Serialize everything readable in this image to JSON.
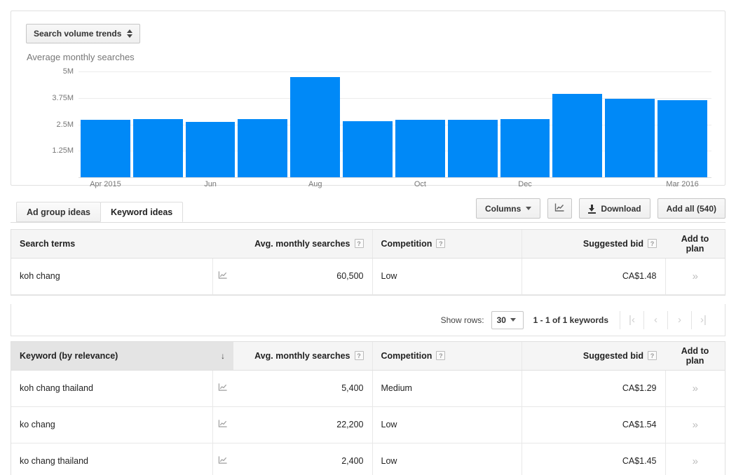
{
  "chart_panel": {
    "trend_selector_label": "Search volume trends",
    "subtitle": "Average monthly searches"
  },
  "chart_data": {
    "type": "bar",
    "title": "Average monthly searches",
    "xlabel": "",
    "ylabel": "",
    "ylim": [
      0,
      5000000
    ],
    "grid": true,
    "legend": false,
    "ytick_labels": [
      "5M",
      "3.75M",
      "2.5M",
      "1.25M"
    ],
    "ytick_values": [
      5000000,
      3750000,
      2500000,
      1250000
    ],
    "categories": [
      "Apr 2015",
      "May 2015",
      "Jun 2015",
      "Jul 2015",
      "Aug 2015",
      "Sep 2015",
      "Oct 2015",
      "Nov 2015",
      "Dec 2015",
      "Jan 2016",
      "Feb 2016",
      "Mar 2016"
    ],
    "visible_xtick_labels": [
      "Apr 2015",
      "",
      "Jun",
      "",
      "Aug",
      "",
      "Oct",
      "",
      "Dec",
      "",
      "",
      "Mar 2016"
    ],
    "values": [
      2700000,
      2750000,
      2600000,
      2750000,
      4750000,
      2650000,
      2700000,
      2720000,
      2760000,
      3950000,
      3700000,
      3650000
    ],
    "bar_color": "#0089f7"
  },
  "tabs": [
    {
      "label": "Ad group ideas",
      "active": false
    },
    {
      "label": "Keyword ideas",
      "active": true
    }
  ],
  "toolbar": {
    "columns_label": "Columns",
    "chart_toggle_label": "",
    "download_label": "Download",
    "add_all_label": "Add all (540)"
  },
  "search_terms_table": {
    "columns": [
      "Search terms",
      "",
      "Avg. monthly searches",
      "Competition",
      "Suggested bid",
      "Add to plan"
    ],
    "help_marker": "?",
    "rows": [
      {
        "keyword": "koh chang",
        "avg_monthly_searches": "60,500",
        "competition": "Low",
        "suggested_bid": "CA$1.48",
        "add_to_plan": "»"
      }
    ]
  },
  "pagination": {
    "show_rows_label": "Show rows:",
    "rows_value": "30",
    "range_label": "1 - 1 of 1 keywords",
    "first_label": "|‹",
    "prev_label": "‹",
    "next_label": "›",
    "last_label": "›|"
  },
  "keyword_ideas_table": {
    "columns": [
      "Keyword (by relevance)",
      "",
      "Avg. monthly searches",
      "Competition",
      "Suggested bid",
      "Add to plan"
    ],
    "help_marker": "?",
    "sort_arrow": "↓",
    "rows": [
      {
        "keyword": "koh chang thailand",
        "avg_monthly_searches": "5,400",
        "competition": "Medium",
        "suggested_bid": "CA$1.29",
        "add_to_plan": "»"
      },
      {
        "keyword": "ko chang",
        "avg_monthly_searches": "22,200",
        "competition": "Low",
        "suggested_bid": "CA$1.54",
        "add_to_plan": "»"
      },
      {
        "keyword": "ko chang thailand",
        "avg_monthly_searches": "2,400",
        "competition": "Low",
        "suggested_bid": "CA$1.45",
        "add_to_plan": "»"
      }
    ]
  }
}
